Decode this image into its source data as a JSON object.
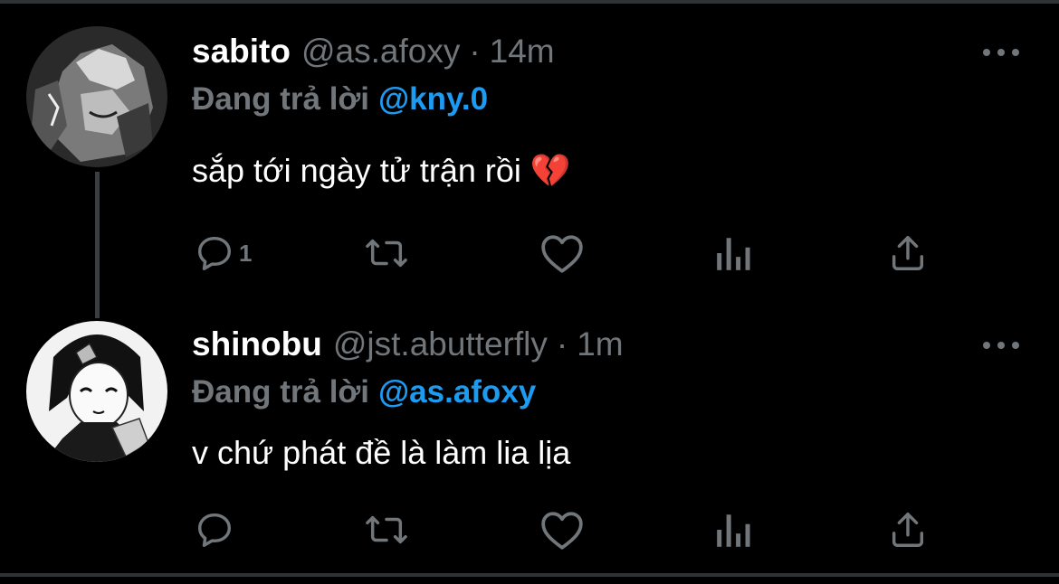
{
  "colors": {
    "background": "#000000",
    "text_primary": "#ffffff",
    "text_secondary": "#71767b",
    "accent_link": "#1d9bf0",
    "icon": "#71767b",
    "broken_heart": "#e0245e"
  },
  "tweets": [
    {
      "display_name": "sabito",
      "handle": "@as.afoxy",
      "separator": "·",
      "time": "14m",
      "reply_prefix": "Đang trả lời",
      "reply_target": "@kny.0",
      "text": " sắp tới ngày tử trận rồi ",
      "emoji": "💔",
      "actions": {
        "reply_icon": "reply-icon",
        "reply_count": "1",
        "retweet_icon": "retweet-icon",
        "like_icon": "heart-icon",
        "views_icon": "analytics-icon",
        "share_icon": "share-icon"
      }
    },
    {
      "display_name": "shinobu",
      "handle": "@jst.abutterfly",
      "separator": "·",
      "time": "1m",
      "reply_prefix": "Đang trả lời",
      "reply_target": "@as.afoxy",
      "text": "v chứ phát đề là làm lia lịa",
      "actions": {
        "reply_icon": "reply-icon",
        "reply_count": "",
        "retweet_icon": "retweet-icon",
        "like_icon": "heart-icon",
        "views_icon": "analytics-icon",
        "share_icon": "share-icon"
      }
    }
  ]
}
